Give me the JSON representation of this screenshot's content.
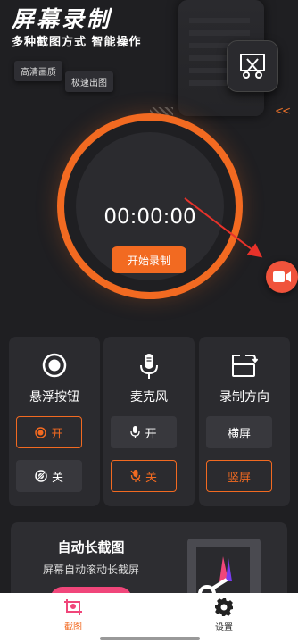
{
  "header": {
    "title": "屏幕录制",
    "subtitle": "多种截图方式 智能操作"
  },
  "tags": [
    "高清画质",
    "极速出图"
  ],
  "recorder": {
    "timer": "00:00:00",
    "start_label": "开始录制"
  },
  "cards": [
    {
      "label": "悬浮按钮",
      "options": [
        {
          "label": "开",
          "selected": true
        },
        {
          "label": "关",
          "selected": false
        }
      ]
    },
    {
      "label": "麦克风",
      "options": [
        {
          "label": "开",
          "selected": false
        },
        {
          "label": "关",
          "selected": true
        }
      ]
    },
    {
      "label": "录制方向",
      "options": [
        {
          "label": "横屏",
          "selected": false
        },
        {
          "label": "竖屏",
          "selected": true
        }
      ]
    }
  ],
  "promo": {
    "title": "自动长截图",
    "subtitle": "屏幕自动滚动长截屏"
  },
  "nav": [
    {
      "label": "截图",
      "active": true
    },
    {
      "label": "设置",
      "active": false
    }
  ],
  "colors": {
    "accent": "#f26a21",
    "float_button": "#f0533b",
    "promo_button": "#f0467a",
    "background": "#1f1f22",
    "card": "#2b2b2f"
  },
  "icons": [
    "scissors-icon",
    "video-camera-icon",
    "record-icon",
    "microphone-icon",
    "rotate-screen-icon",
    "screenshot-icon",
    "gear-icon"
  ]
}
